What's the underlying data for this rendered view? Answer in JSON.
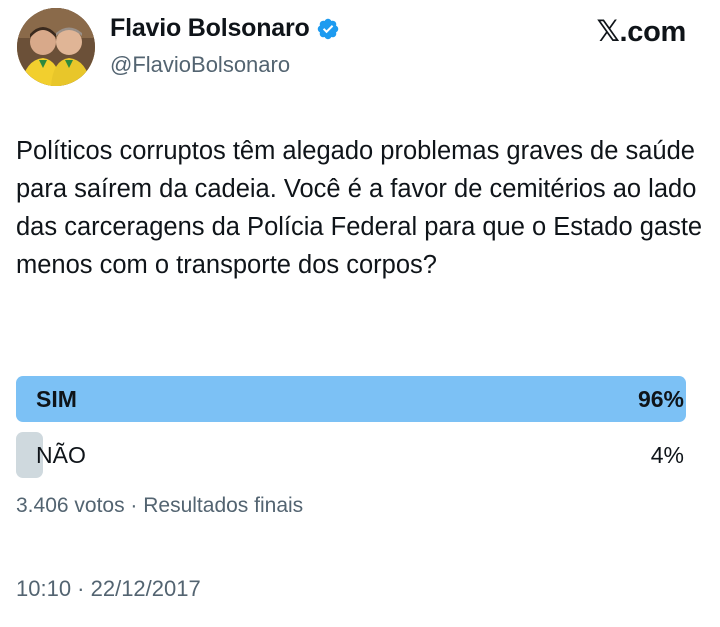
{
  "author": {
    "display_name": "Flavio Bolsonaro",
    "handle": "@FlavioBolsonaro",
    "verified_icon": "verified-badge-icon"
  },
  "brand": "𝕏.com",
  "tweet": {
    "text": "Políticos corruptos têm alegado problemas graves de saúde para saírem da cadeia. Você é a favor de cemitérios ao lado das carceragens da Polícia Federal para que o Estado gaste menos com o transporte dos corpos?"
  },
  "poll": {
    "options": [
      {
        "label": "SIM",
        "percent_text": "96%",
        "percent": 96,
        "winner": true
      },
      {
        "label": "NÃO",
        "percent_text": "4%",
        "percent": 4,
        "winner": false
      }
    ],
    "meta": "3.406 votos · Resultados finais"
  },
  "timestamp": "10:10 · 22/12/2017",
  "colors": {
    "winner_bar": "#7cc1f5",
    "loser_bar": "#cfd9de",
    "verified": "#1d9bf0",
    "secondary_text": "#536471"
  }
}
